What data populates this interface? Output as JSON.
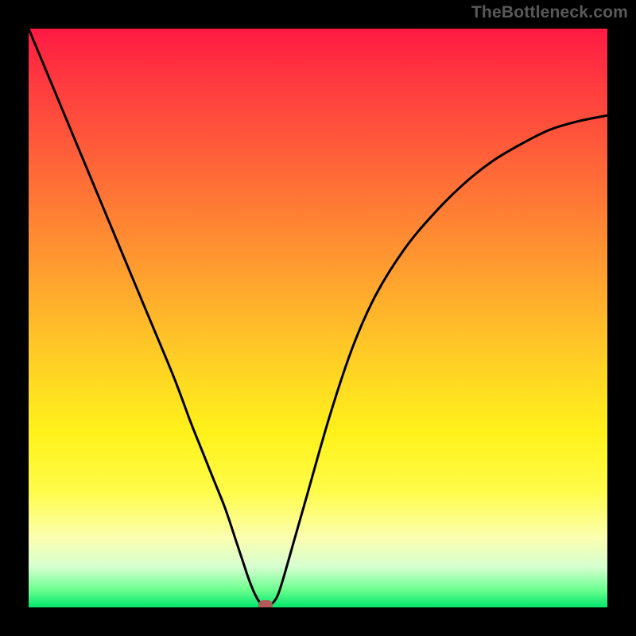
{
  "watermark": {
    "text": "TheBottleneck.com"
  },
  "chart_data": {
    "type": "line",
    "title": "",
    "xlabel": "",
    "ylabel": "",
    "xlim": [
      0,
      100
    ],
    "ylim": [
      0,
      100
    ],
    "background_gradient": {
      "stops": [
        {
          "pct": 0,
          "color": "#ff1a43"
        },
        {
          "pct": 50,
          "color": "#ffb82a"
        },
        {
          "pct": 80,
          "color": "#fffc4a"
        },
        {
          "pct": 100,
          "color": "#00e56a"
        }
      ]
    },
    "series": [
      {
        "name": "bottleneck-curve",
        "color": "#000000",
        "x": [
          0,
          5,
          10,
          15,
          20,
          25,
          28,
          30,
          32,
          34,
          36,
          37,
          38,
          39,
          40,
          41,
          42,
          43,
          44,
          46,
          48,
          52,
          56,
          60,
          65,
          70,
          75,
          80,
          85,
          90,
          95,
          100
        ],
        "values": [
          100,
          88,
          76,
          64,
          52,
          40,
          32,
          27,
          22,
          17,
          11,
          8,
          5,
          2.5,
          0.8,
          0.4,
          0.6,
          2,
          5,
          12,
          19,
          33,
          45,
          54,
          62,
          68,
          73,
          77,
          80,
          82.5,
          84,
          85
        ]
      }
    ],
    "marker": {
      "x": 41,
      "y": 0.4,
      "color": "#b25a5a"
    }
  }
}
